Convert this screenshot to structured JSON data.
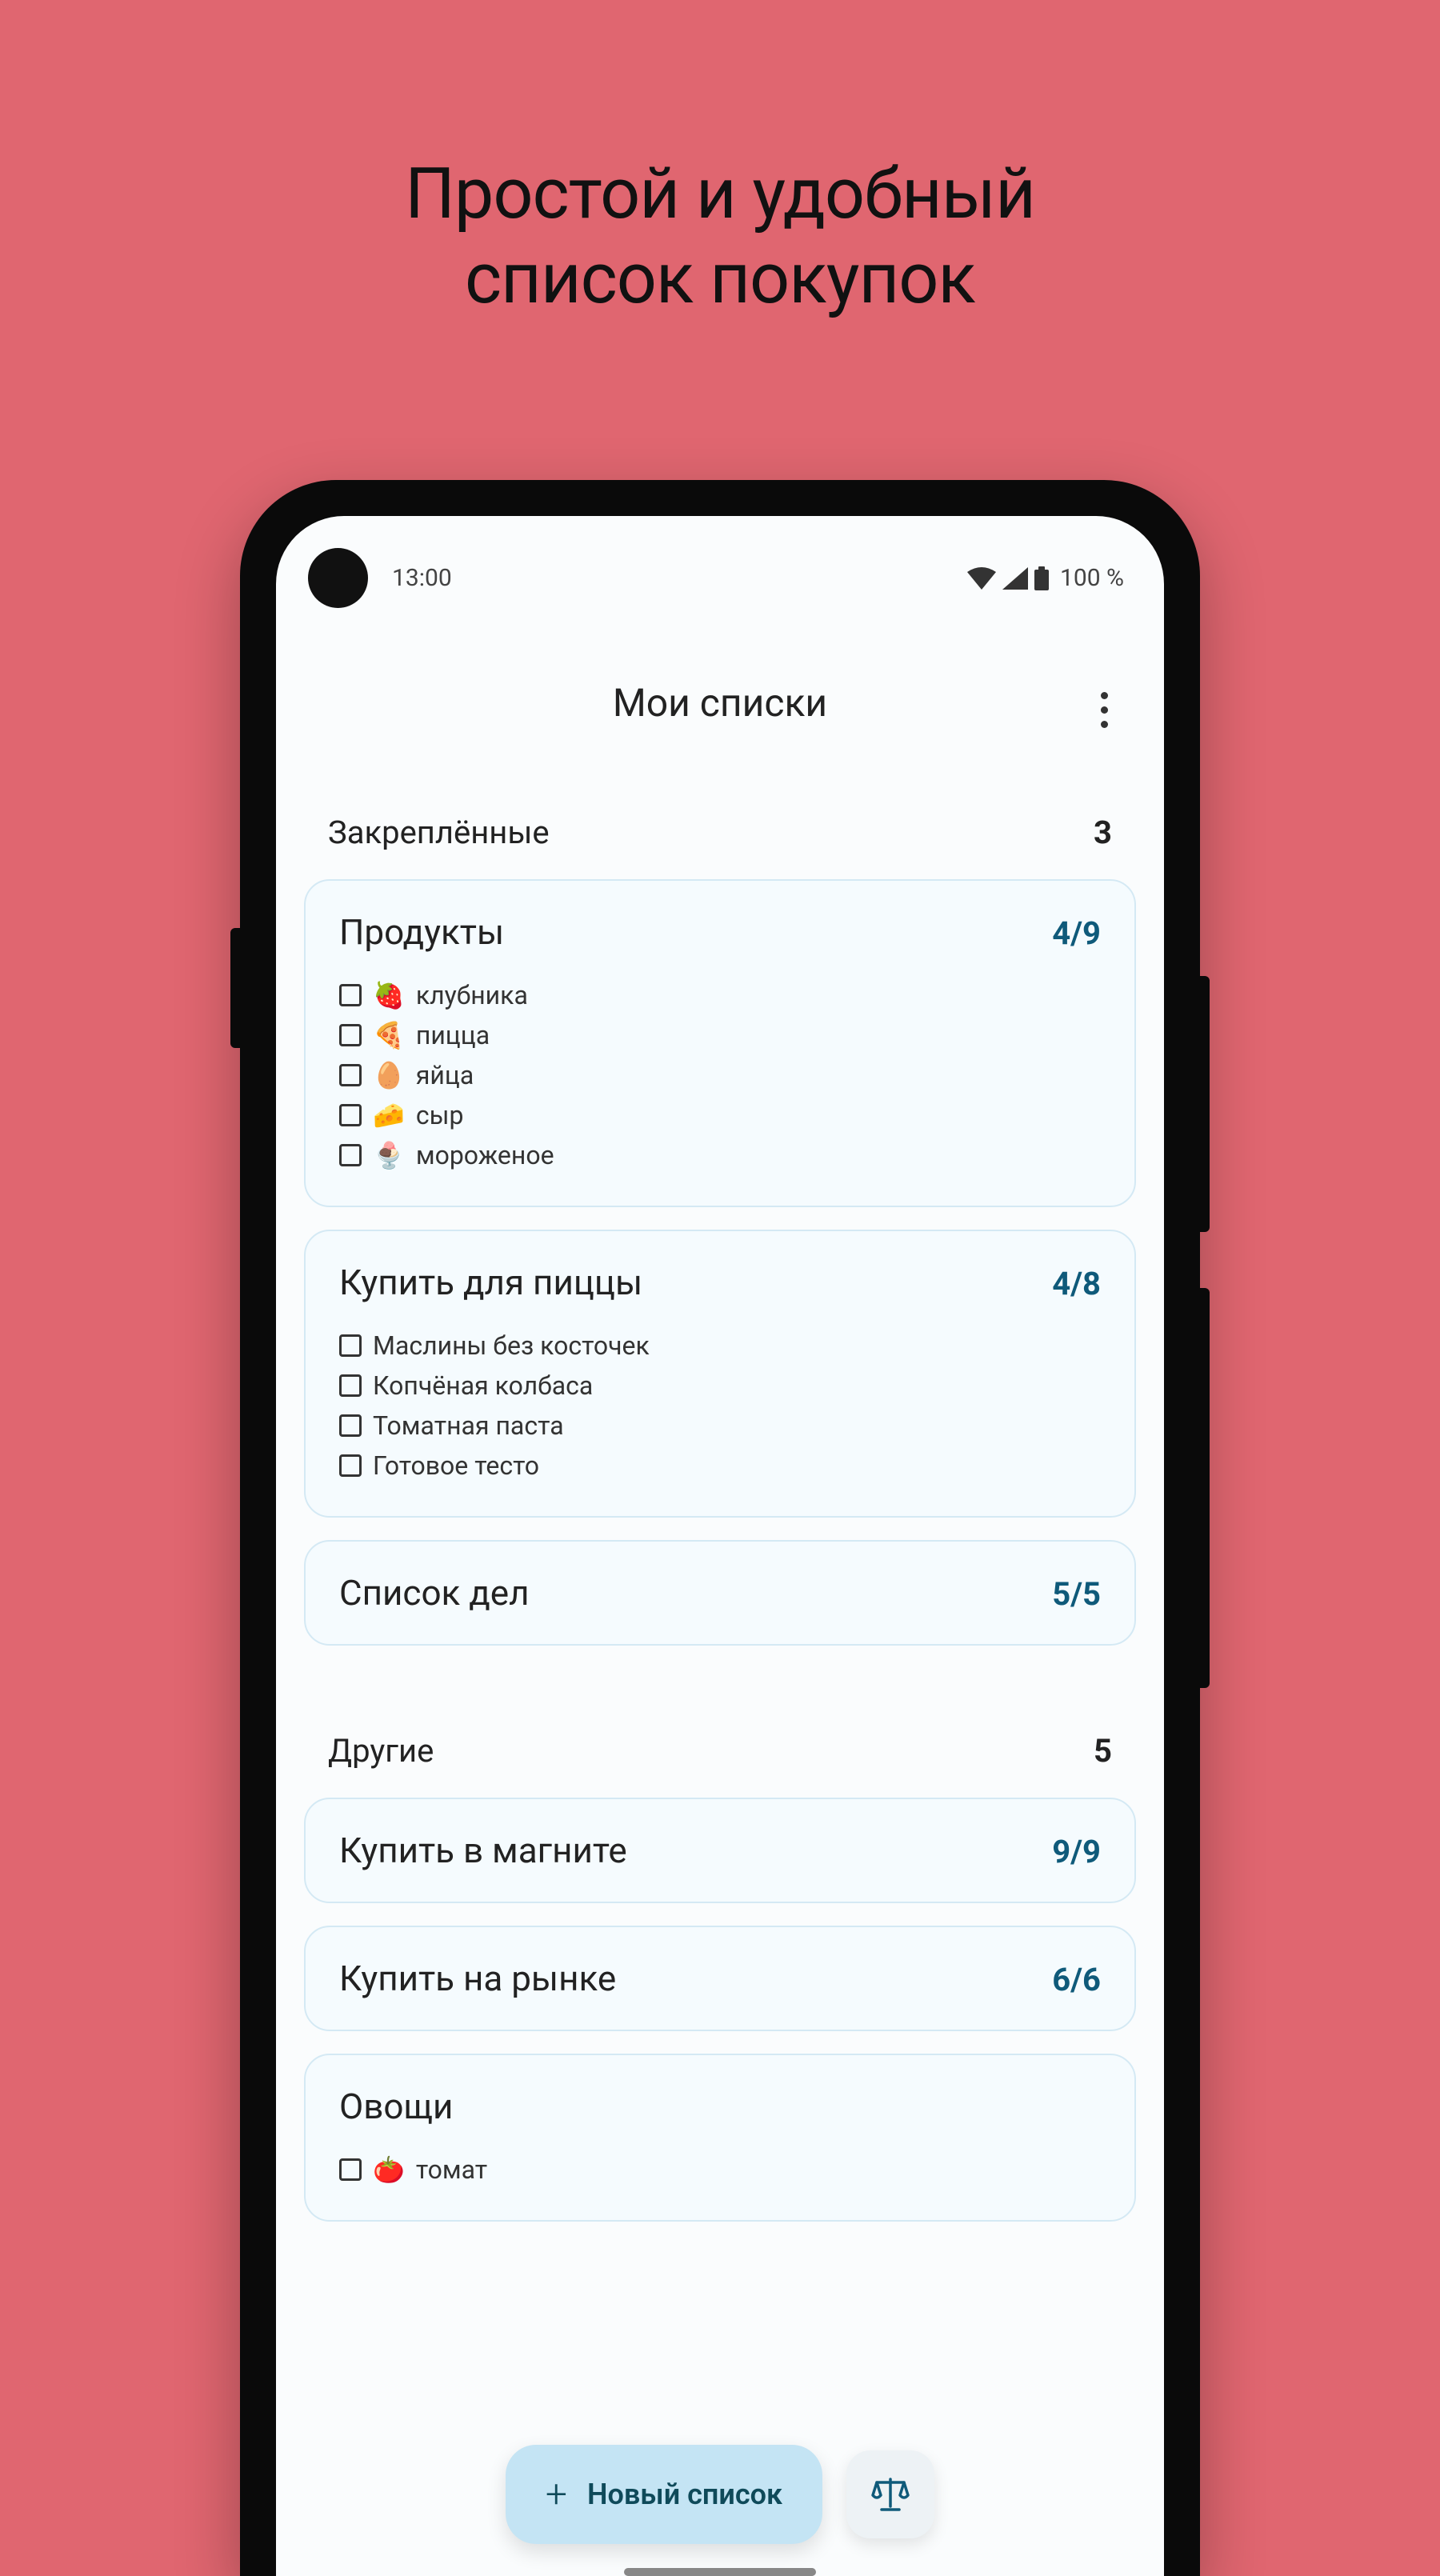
{
  "marketing": {
    "title_line1": "Простой и удобный",
    "title_line2": "список покупок"
  },
  "status": {
    "time": "13:00",
    "battery": "100 %"
  },
  "header": {
    "title": "Мои списки"
  },
  "sections": [
    {
      "label": "Закреплённые",
      "count": "3",
      "cards": [
        {
          "title": "Продукты",
          "progress": "4/9",
          "items": [
            {
              "emoji": "🍓",
              "label": "клубника"
            },
            {
              "emoji": "🍕",
              "label": "пицца"
            },
            {
              "emoji": "🥚",
              "label": "яйца"
            },
            {
              "emoji": "🧀",
              "label": "сыр"
            },
            {
              "emoji": "🍨",
              "label": "мороженое"
            }
          ]
        },
        {
          "title": "Купить для пиццы",
          "progress": "4/8",
          "items": [
            {
              "emoji": "",
              "label": "Маслины без косточек"
            },
            {
              "emoji": "",
              "label": "Копчёная колбаса"
            },
            {
              "emoji": "",
              "label": "Томатная паста"
            },
            {
              "emoji": "",
              "label": "Готовое тесто"
            }
          ]
        },
        {
          "title": "Список дел",
          "progress": "5/5",
          "items": []
        }
      ]
    },
    {
      "label": "Другие",
      "count": "5",
      "cards": [
        {
          "title": "Купить в магните",
          "progress": "9/9",
          "items": []
        },
        {
          "title": "Купить на рынке",
          "progress": "6/6",
          "items": []
        },
        {
          "title": "Овощи",
          "progress": "",
          "items": [
            {
              "emoji": "🍅",
              "label": "томат"
            }
          ]
        }
      ]
    }
  ],
  "fab": {
    "label": "Новый список"
  }
}
